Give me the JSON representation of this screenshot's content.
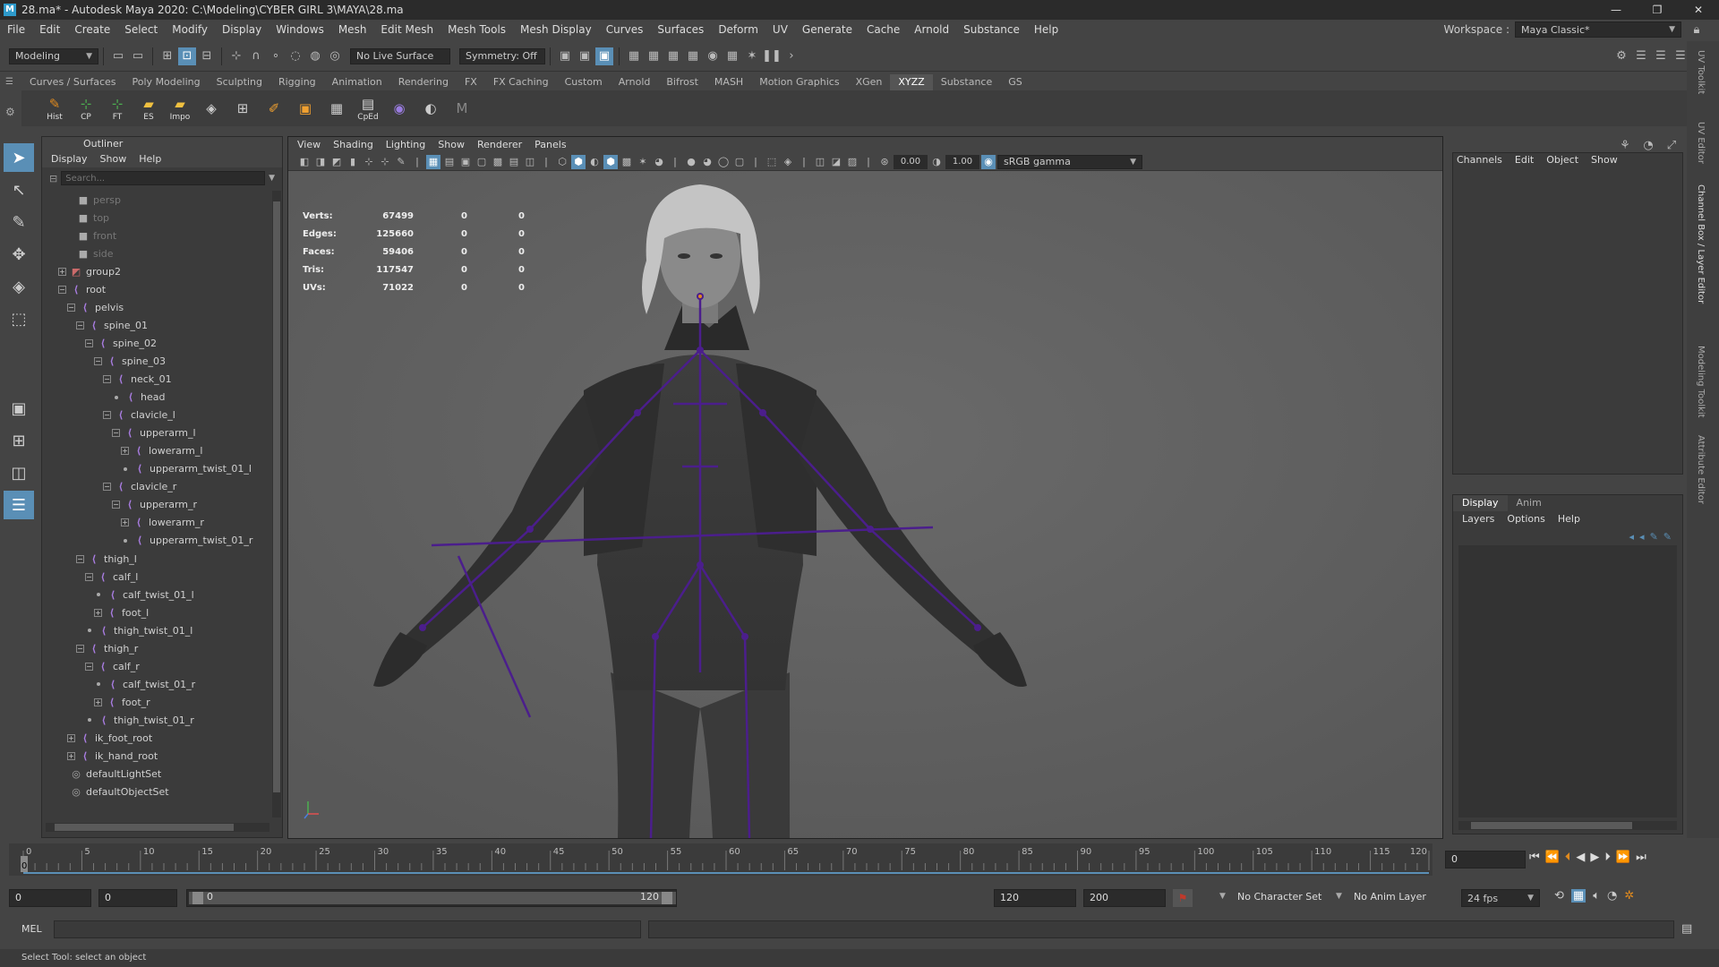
{
  "window": {
    "title": "28.ma* - Autodesk Maya 2020: C:\\Modeling\\CYBER GIRL 3\\MAYA\\28.ma",
    "controls": [
      "—",
      "❐",
      "✕"
    ]
  },
  "menubar": [
    "File",
    "Edit",
    "Create",
    "Select",
    "Modify",
    "Display",
    "Windows",
    "Mesh",
    "Edit Mesh",
    "Mesh Tools",
    "Mesh Display",
    "Curves",
    "Surfaces",
    "Deform",
    "UV",
    "Generate",
    "Cache",
    "Arnold",
    "Substance",
    "Help"
  ],
  "workspace": {
    "label": "Workspace :",
    "value": "Maya Classic*"
  },
  "statusline": {
    "mode": "Modeling",
    "live_surface": "No Live Surface",
    "symmetry": "Symmetry: Off"
  },
  "shelf": {
    "tabs": [
      "Curves / Surfaces",
      "Poly Modeling",
      "Sculpting",
      "Rigging",
      "Animation",
      "Rendering",
      "FX",
      "FX Caching",
      "Custom",
      "Arnold",
      "Bifrost",
      "MASH",
      "Motion Graphics",
      "XGen",
      "XYZZ",
      "Substance",
      "GS"
    ],
    "active_tab": "XYZZ",
    "buttons": [
      {
        "label": "Hist",
        "icon": "history-icon",
        "glyph": "✎"
      },
      {
        "label": "CP",
        "icon": "center-pivot-icon",
        "glyph": "⊹"
      },
      {
        "label": "FT",
        "icon": "freeze-transform-icon",
        "glyph": "⊹"
      },
      {
        "label": "ES",
        "icon": "folder-icon",
        "glyph": "▰"
      },
      {
        "label": "Impo",
        "icon": "import-icon",
        "glyph": "▰"
      },
      {
        "label": "",
        "icon": "lasso-icon",
        "glyph": "◈"
      },
      {
        "label": "",
        "icon": "grid-icon",
        "glyph": "⊞"
      },
      {
        "label": "",
        "icon": "brush-icon",
        "glyph": "✐"
      },
      {
        "label": "",
        "icon": "box-icon",
        "glyph": "▣"
      },
      {
        "label": "",
        "icon": "mesh-icon",
        "glyph": "▦"
      },
      {
        "label": "CpEd",
        "icon": "component-editor-icon",
        "glyph": "▤"
      },
      {
        "label": "",
        "icon": "hypershade-icon",
        "glyph": "◉"
      },
      {
        "label": "",
        "icon": "sphere-icon",
        "glyph": "◐"
      },
      {
        "label": "",
        "icon": "maya-logo-icon",
        "glyph": "M"
      }
    ]
  },
  "outliner": {
    "title": "Outliner",
    "menus": [
      "Display",
      "Show",
      "Help"
    ],
    "search_placeholder": "Search...",
    "items": [
      {
        "label": "persp",
        "depth": 0,
        "type": "camera",
        "exp": "",
        "dim": true
      },
      {
        "label": "top",
        "depth": 0,
        "type": "camera",
        "exp": "",
        "dim": true
      },
      {
        "label": "front",
        "depth": 0,
        "type": "camera",
        "exp": "",
        "dim": true
      },
      {
        "label": "side",
        "depth": 0,
        "type": "camera",
        "exp": "",
        "dim": true
      },
      {
        "label": "group2",
        "depth": 0,
        "type": "group",
        "exp": "+"
      },
      {
        "label": "root",
        "depth": 0,
        "type": "joint",
        "exp": "−"
      },
      {
        "label": "pelvis",
        "depth": 1,
        "type": "joint",
        "exp": "−"
      },
      {
        "label": "spine_01",
        "depth": 2,
        "type": "joint",
        "exp": "−"
      },
      {
        "label": "spine_02",
        "depth": 3,
        "type": "joint",
        "exp": "−"
      },
      {
        "label": "spine_03",
        "depth": 4,
        "type": "joint",
        "exp": "−"
      },
      {
        "label": "neck_01",
        "depth": 5,
        "type": "joint",
        "exp": "−"
      },
      {
        "label": "head",
        "depth": 6,
        "type": "joint",
        "exp": "•"
      },
      {
        "label": "clavicle_l",
        "depth": 5,
        "type": "joint",
        "exp": "−"
      },
      {
        "label": "upperarm_l",
        "depth": 6,
        "type": "joint",
        "exp": "−"
      },
      {
        "label": "lowerarm_l",
        "depth": 7,
        "type": "joint",
        "exp": "+"
      },
      {
        "label": "upperarm_twist_01_l",
        "depth": 7,
        "type": "joint",
        "exp": "•"
      },
      {
        "label": "clavicle_r",
        "depth": 5,
        "type": "joint",
        "exp": "−"
      },
      {
        "label": "upperarm_r",
        "depth": 6,
        "type": "joint",
        "exp": "−"
      },
      {
        "label": "lowerarm_r",
        "depth": 7,
        "type": "joint",
        "exp": "+"
      },
      {
        "label": "upperarm_twist_01_r",
        "depth": 7,
        "type": "joint",
        "exp": "•"
      },
      {
        "label": "thigh_l",
        "depth": 2,
        "type": "joint",
        "exp": "−"
      },
      {
        "label": "calf_l",
        "depth": 3,
        "type": "joint",
        "exp": "−"
      },
      {
        "label": "calf_twist_01_l",
        "depth": 4,
        "type": "joint",
        "exp": "•"
      },
      {
        "label": "foot_l",
        "depth": 4,
        "type": "joint",
        "exp": "+"
      },
      {
        "label": "thigh_twist_01_l",
        "depth": 3,
        "type": "joint",
        "exp": "•"
      },
      {
        "label": "thigh_r",
        "depth": 2,
        "type": "joint",
        "exp": "−"
      },
      {
        "label": "calf_r",
        "depth": 3,
        "type": "joint",
        "exp": "−"
      },
      {
        "label": "calf_twist_01_r",
        "depth": 4,
        "type": "joint",
        "exp": "•"
      },
      {
        "label": "foot_r",
        "depth": 4,
        "type": "joint",
        "exp": "+"
      },
      {
        "label": "thigh_twist_01_r",
        "depth": 3,
        "type": "joint",
        "exp": "•"
      },
      {
        "label": "ik_foot_root",
        "depth": 1,
        "type": "joint",
        "exp": "+"
      },
      {
        "label": "ik_hand_root",
        "depth": 1,
        "type": "joint",
        "exp": "+"
      },
      {
        "label": "defaultLightSet",
        "depth": 0,
        "type": "set",
        "exp": ""
      },
      {
        "label": "defaultObjectSet",
        "depth": 0,
        "type": "set",
        "exp": ""
      }
    ]
  },
  "viewport": {
    "menus": [
      "View",
      "Shading",
      "Lighting",
      "Show",
      "Renderer",
      "Panels"
    ],
    "exposure": "0.00",
    "gamma": "1.00",
    "colorspace": "sRGB gamma",
    "camera": "persp",
    "hud": [
      {
        "label": "Verts:",
        "value": "67499",
        "sel": "0",
        "comp": "0"
      },
      {
        "label": "Edges:",
        "value": "125660",
        "sel": "0",
        "comp": "0"
      },
      {
        "label": "Faces:",
        "value": "59406",
        "sel": "0",
        "comp": "0"
      },
      {
        "label": "Tris:",
        "value": "117547",
        "sel": "0",
        "comp": "0"
      },
      {
        "label": "UVs:",
        "value": "71022",
        "sel": "0",
        "comp": "0"
      }
    ]
  },
  "channelbox": {
    "menus": [
      "Channels",
      "Edit",
      "Object",
      "Show"
    ]
  },
  "layereditor": {
    "tabs": [
      "Display",
      "Anim"
    ],
    "active_tab": "Display",
    "menus": [
      "Layers",
      "Options",
      "Help"
    ]
  },
  "sidetabs": [
    "UV Toolkit",
    "UV Editor",
    "Channel Box / Layer Editor",
    "Modeling Toolkit",
    "Attribute Editor"
  ],
  "timeslider": {
    "ticks": [
      "0",
      "5",
      "10",
      "15",
      "20",
      "25",
      "30",
      "35",
      "40",
      "45",
      "50",
      "55",
      "60",
      "65",
      "70",
      "75",
      "80",
      "85",
      "90",
      "95",
      "100",
      "105",
      "110",
      "115",
      "120"
    ],
    "current_frame": "0",
    "playback_start": "0",
    "playback_end": 120
  },
  "range": {
    "start": "0",
    "playback_start": "0",
    "slider_start": "0",
    "slider_end": "120",
    "playback_end": "120",
    "end": "200",
    "character_set": "No Character Set",
    "anim_layer": "No Anim Layer",
    "fps": "24 fps"
  },
  "cmdline": {
    "label": "MEL"
  },
  "helpline": "Select Tool: select an object",
  "colors": {
    "accent": "#5a8fb6",
    "joint": "#4b1e8c",
    "timeline_cursor": "#c0392b"
  }
}
